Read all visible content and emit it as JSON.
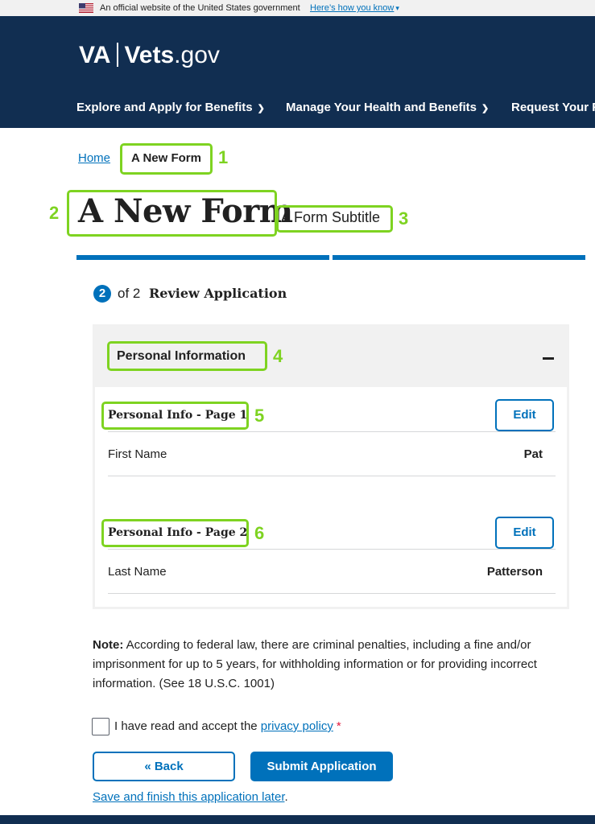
{
  "gov_banner": {
    "text": "An official website of the United States government",
    "link": "Here’s how you know"
  },
  "header": {
    "logo_va": "VA",
    "logo_vets": "Vets",
    "logo_gov": ".gov",
    "nav": [
      {
        "label": "Explore and Apply for Benefits"
      },
      {
        "label": "Manage Your Health and Benefits"
      },
      {
        "label": "Request Your R"
      }
    ]
  },
  "breadcrumb": {
    "home": "Home",
    "current": "A New Form"
  },
  "form": {
    "title": "A New Form",
    "subtitle": "A Form Subtitle",
    "step_number": "2",
    "step_of": "of 2",
    "step_title": "Review Application"
  },
  "review": {
    "chapter_title": "Personal Information",
    "pages": [
      {
        "title": "Personal Info - Page 1",
        "edit_label": "Edit",
        "field_label": "First Name",
        "field_value": "Pat"
      },
      {
        "title": "Personal Info - Page 2",
        "edit_label": "Edit",
        "field_label": "Last Name",
        "field_value": "Patterson"
      }
    ]
  },
  "note": {
    "label": "Note:",
    "text": "According to federal law, there are criminal penalties, including a fine and/or imprisonment for up to 5 years, for withholding information or for providing incorrect information. (See 18 U.S.C. 1001)"
  },
  "consent": {
    "text": "I have read and accept the ",
    "link": "privacy policy",
    "required_mark": "*"
  },
  "actions": {
    "back_label": "« Back",
    "submit_label": "Submit Application",
    "save_later_link": "Save and finish this application later",
    "save_later_suffix": "."
  },
  "annotations": [
    "1",
    "2",
    "3",
    "4",
    "5",
    "6"
  ],
  "colors": {
    "header_bg": "#112e51",
    "primary": "#0071bb",
    "annotation": "#7ed321",
    "required": "#e31c3d"
  }
}
